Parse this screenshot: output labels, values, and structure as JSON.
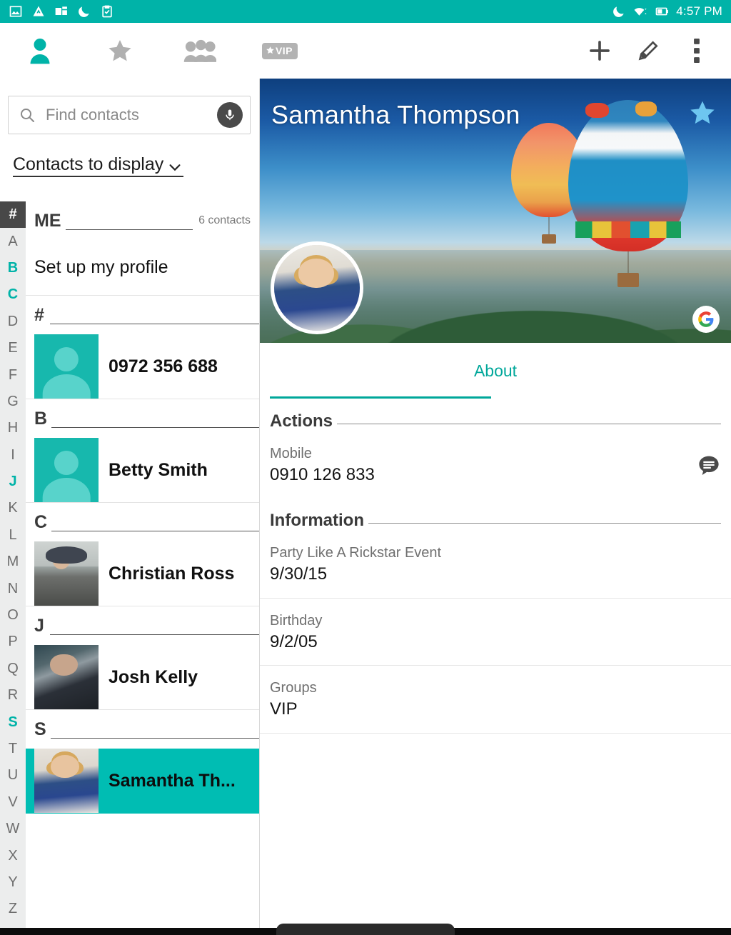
{
  "status_bar": {
    "time": "4:57 PM",
    "left_icons": [
      "photo-icon",
      "drive-triangle-icon",
      "news-icon",
      "do-not-disturb-moon-icon",
      "clipboard-check-icon"
    ],
    "right_icons": [
      "do-not-disturb-moon-icon",
      "wifi-icon",
      "battery-icon"
    ],
    "background": "#00b3a8"
  },
  "toolbar": {
    "tabs": [
      {
        "name": "contacts-tab",
        "icon": "person-icon",
        "active": true
      },
      {
        "name": "favorites-tab",
        "icon": "star-icon",
        "active": false
      },
      {
        "name": "groups-tab",
        "icon": "people-group-icon",
        "active": false
      },
      {
        "name": "vip-tab",
        "icon": "vip-badge-icon",
        "label": "VIP",
        "active": false
      }
    ],
    "actions": [
      {
        "name": "add-contact-button",
        "icon": "plus-icon"
      },
      {
        "name": "edit-contact-button",
        "icon": "pencil-icon"
      },
      {
        "name": "overflow-menu-button",
        "icon": "more-vertical-icon"
      }
    ],
    "accent_color": "#00b3a8"
  },
  "sidebar": {
    "search": {
      "placeholder": "Find contacts",
      "value": "",
      "icon": "search-icon",
      "mic_icon": "microphone-icon"
    },
    "contacts_to_display": {
      "label": "Contacts to display",
      "chevron": "chevron-down-icon"
    },
    "index": {
      "hash": "#",
      "letters": [
        "A",
        "B",
        "C",
        "D",
        "E",
        "F",
        "G",
        "H",
        "I",
        "J",
        "K",
        "L",
        "M",
        "N",
        "O",
        "P",
        "Q",
        "R",
        "S",
        "T",
        "U",
        "V",
        "W",
        "X",
        "Y",
        "Z"
      ],
      "active_letters": [
        "B",
        "C",
        "J",
        "S"
      ],
      "active_color": "#00b3a8"
    },
    "me_section": {
      "title": "ME",
      "count": "6 contacts",
      "profile_row": "Set up my profile"
    },
    "sections": [
      {
        "letter": "#",
        "contacts": [
          {
            "name": "0972 356 688",
            "avatar": "placeholder",
            "selected": false
          }
        ]
      },
      {
        "letter": "B",
        "contacts": [
          {
            "name": "Betty Smith",
            "avatar": "placeholder",
            "selected": false
          }
        ]
      },
      {
        "letter": "C",
        "contacts": [
          {
            "name": "Christian Ross",
            "avatar": "photo-christian",
            "selected": false
          }
        ]
      },
      {
        "letter": "J",
        "contacts": [
          {
            "name": "Josh Kelly",
            "avatar": "photo-josh",
            "selected": false
          }
        ]
      },
      {
        "letter": "S",
        "contacts": [
          {
            "name": "Samantha Th...",
            "avatar": "photo-samantha",
            "selected": true
          }
        ]
      }
    ],
    "selected_background": "#00bdb3"
  },
  "detail": {
    "hero": {
      "name": "Samantha Thompson",
      "star_icon": "star-icon",
      "star_color": "#6ec6f0",
      "account_icon": "google-logo-icon",
      "cover_description": "hot-air-balloons-over-mountains"
    },
    "tab": {
      "label": "About",
      "active": true,
      "color": "#00a79a"
    },
    "actions_section": {
      "title": "Actions",
      "items": [
        {
          "label": "Mobile",
          "value": "0910 126 833",
          "action_icon": "message-bubble-icon"
        }
      ]
    },
    "information_section": {
      "title": "Information",
      "items": [
        {
          "label": "Party Like A Rickstar Event",
          "value": "9/30/15"
        },
        {
          "label": "Birthday",
          "value": "9/2/05"
        },
        {
          "label": "Groups",
          "value": "VIP"
        }
      ]
    }
  }
}
